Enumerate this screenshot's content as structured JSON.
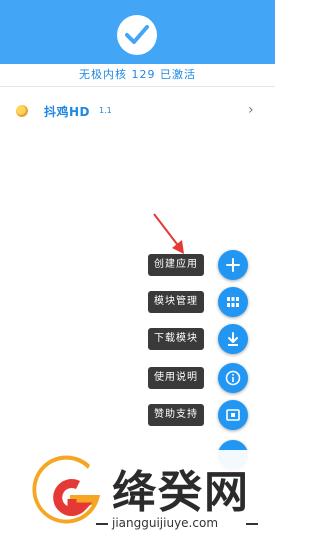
{
  "header": {
    "status_text": "无极内核 129 已激活"
  },
  "app": {
    "name": "抖鸡HD",
    "version": "1.1"
  },
  "fab_menu": [
    {
      "label": "创建应用",
      "icon": "plus-icon"
    },
    {
      "label": "模块管理",
      "icon": "grid-icon"
    },
    {
      "label": "下载模块",
      "icon": "download-icon"
    },
    {
      "label": "使用说明",
      "icon": "info-icon"
    },
    {
      "label": "赞助支持",
      "icon": "sponsor-icon"
    }
  ],
  "watermark": {
    "title": "绛癸网",
    "url": "jiangguijiuye.com"
  },
  "colors": {
    "accent": "#2196f3",
    "header": "#42a5f5",
    "label_bg": "#3a3a3a",
    "arrow": "#e53935"
  }
}
